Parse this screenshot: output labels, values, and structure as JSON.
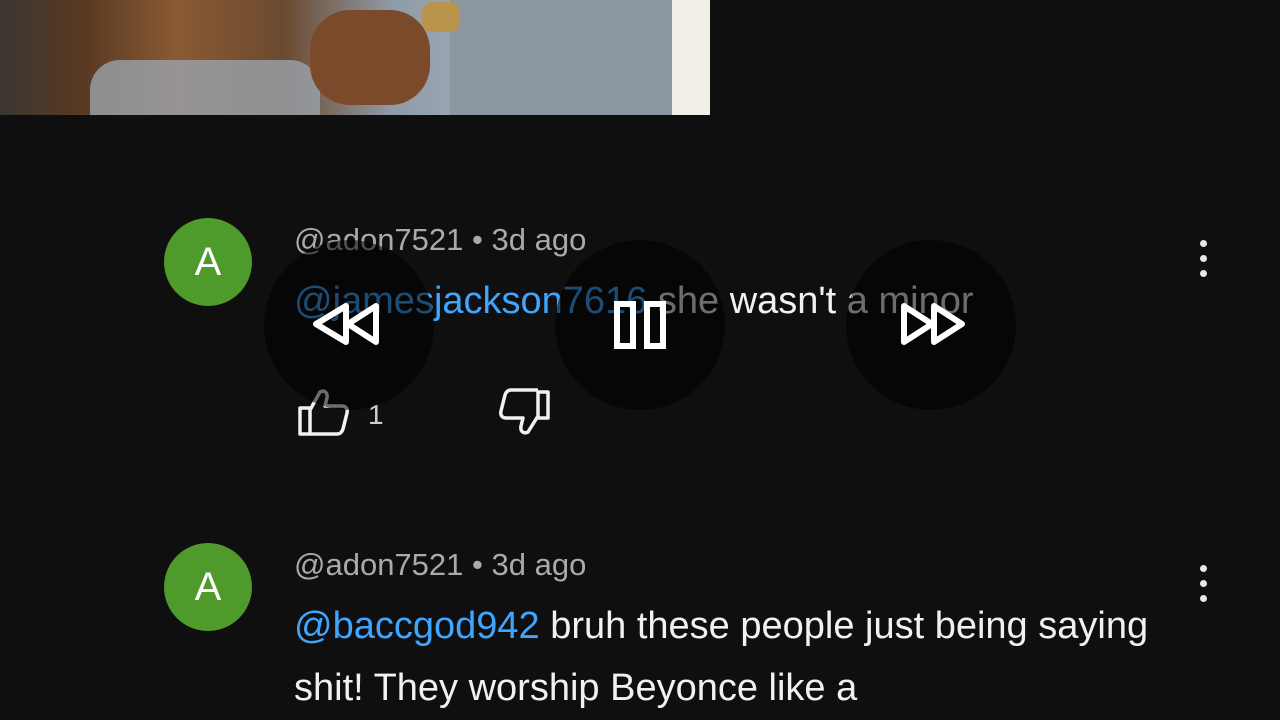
{
  "comments": [
    {
      "avatar_letter": "A",
      "username": "@adon7521",
      "separator": "•",
      "time": "3d ago",
      "mention": "@jamesjackson7616",
      "text": " she wasn't a minor",
      "likes": "1"
    },
    {
      "avatar_letter": "A",
      "username": "@adon7521",
      "separator": "•",
      "time": "3d ago",
      "mention": "@baccgod942",
      "text": " bruh these people just being saying shit! They worship Beyonce like a"
    }
  ],
  "icons": {
    "rewind": "rewind-icon",
    "pause": "pause-icon",
    "fast_forward": "fast-forward-icon",
    "like": "thumbs-up-icon",
    "dislike": "thumbs-down-icon",
    "more": "more-vertical-icon"
  },
  "colors": {
    "background": "#0f0f0f",
    "mention": "#3ea6ff",
    "avatar": "#4e9a2a",
    "meta": "#aaaaaa"
  }
}
